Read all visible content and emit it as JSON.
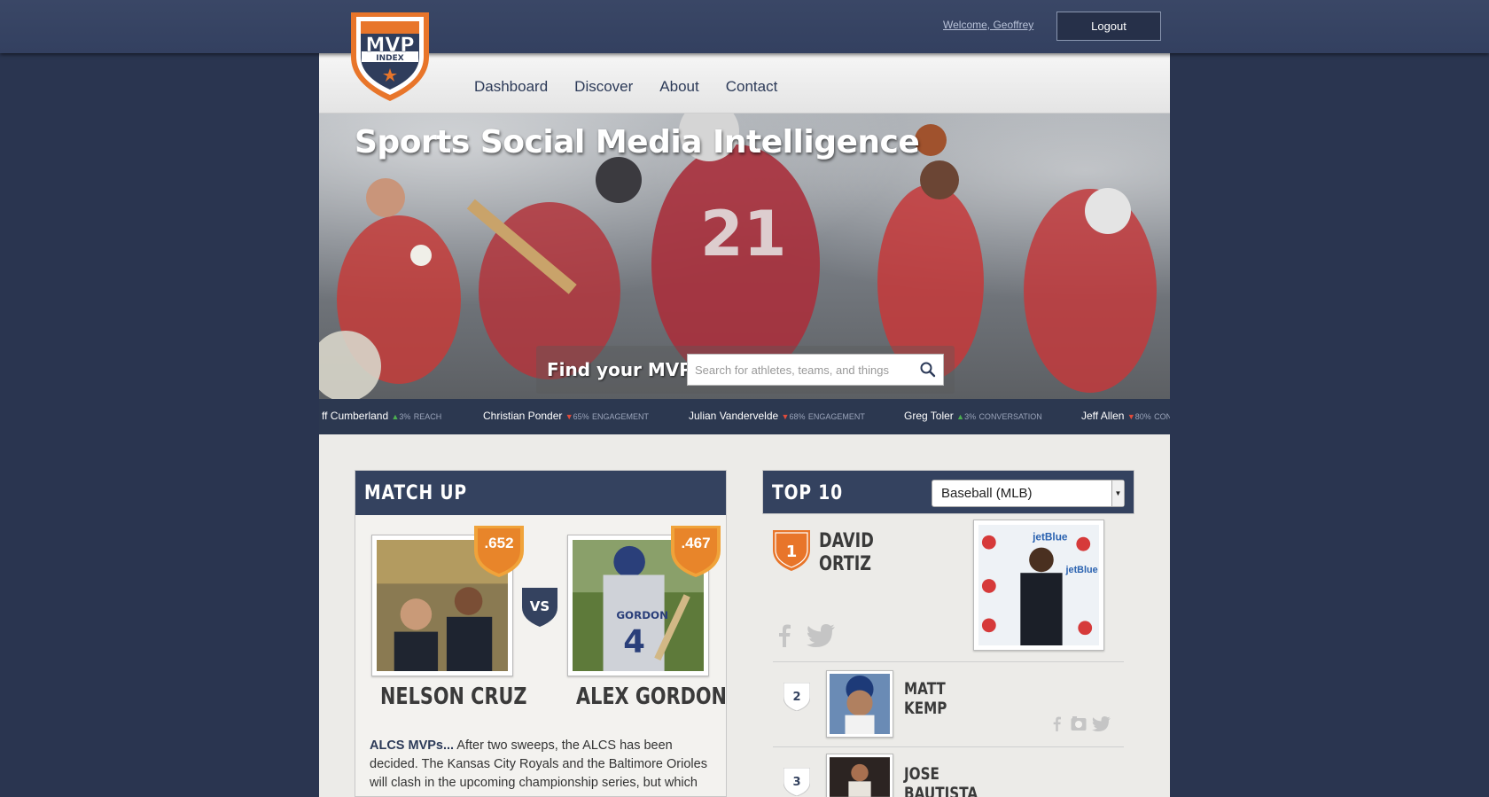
{
  "header": {
    "welcome": "Welcome, Geoffrey",
    "logout": "Logout"
  },
  "logo": {
    "line1": "MVP",
    "line2": "INDEX"
  },
  "nav": {
    "items": [
      "Dashboard",
      "Discover",
      "About",
      "Contact"
    ]
  },
  "hero": {
    "title": "Sports Social Media Intelligence",
    "find_label": "Find your MVP:",
    "search_placeholder": "Search for athletes, teams, and things"
  },
  "ticker": [
    {
      "name": "ff Cumberland",
      "dir": "up",
      "value": "3%",
      "metric": "REACH"
    },
    {
      "name": "Christian Ponder",
      "dir": "down",
      "value": "65%",
      "metric": "ENGAGEMENT"
    },
    {
      "name": "Julian Vandervelde",
      "dir": "down",
      "value": "68%",
      "metric": "ENGAGEMENT"
    },
    {
      "name": "Greg Toler",
      "dir": "up",
      "value": "3%",
      "metric": "CONVERSATION"
    },
    {
      "name": "Jeff Allen",
      "dir": "down",
      "value": "80%",
      "metric": "CON"
    }
  ],
  "matchup": {
    "title": "MATCH UP",
    "vs": "VS",
    "left": {
      "name": "NELSON CRUZ",
      "score": ".652"
    },
    "right": {
      "name": "ALEX GORDON",
      "score": ".467"
    },
    "blurb_lead": "ALCS MVPs...",
    "blurb": " After two sweeps, the ALCS has been decided. The Kansas City Royals and the Baltimore Orioles will clash in the upcoming championship series, but which"
  },
  "top10": {
    "title": "TOP 10",
    "selected_sport": "Baseball (MLB)",
    "leader": {
      "rank": "1",
      "first": "DAVID",
      "last": "ORTIZ"
    },
    "rows": [
      {
        "rank": "2",
        "first": "MATT",
        "last": "KEMP"
      },
      {
        "rank": "3",
        "first": "JOSE",
        "last": "BAUTISTA"
      }
    ]
  },
  "colors": {
    "navy": "#34425f",
    "orange": "#e8752a",
    "background": "#2a3550"
  }
}
